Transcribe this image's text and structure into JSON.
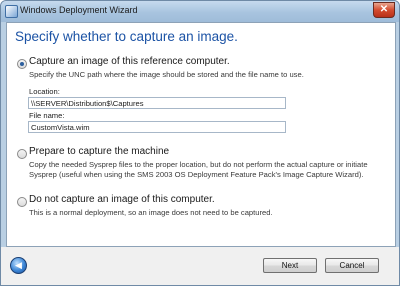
{
  "window": {
    "title": "Windows Deployment Wizard",
    "close_glyph": "✕"
  },
  "page": {
    "heading": "Specify whether to capture an image."
  },
  "options": [
    {
      "label": "Capture an image of this reference computer.",
      "selected": true,
      "description": "Specify the UNC path where the image should be stored and the file name to use."
    },
    {
      "label": "Prepare to capture the machine",
      "selected": false,
      "description_line1": "Copy the needed Sysprep files to the proper location, but do not perform the actual capture or initiate",
      "description_line2": "Sysprep (useful when using the SMS 2003 OS Deployment Feature Pack's Image Capture Wizard)."
    },
    {
      "label": "Do not capture an image of this computer.",
      "selected": false,
      "description": "This is a normal deployment, so an image does not need to be captured."
    }
  ],
  "fields": {
    "location_label": "Location:",
    "location_value": "\\\\SERVER\\Distribution$\\Captures",
    "filename_label": "File name:",
    "filename_value": "CustomVista.wim"
  },
  "footer": {
    "back_icon": "back-arrow-icon",
    "next_label": "Next",
    "cancel_label": "Cancel"
  }
}
